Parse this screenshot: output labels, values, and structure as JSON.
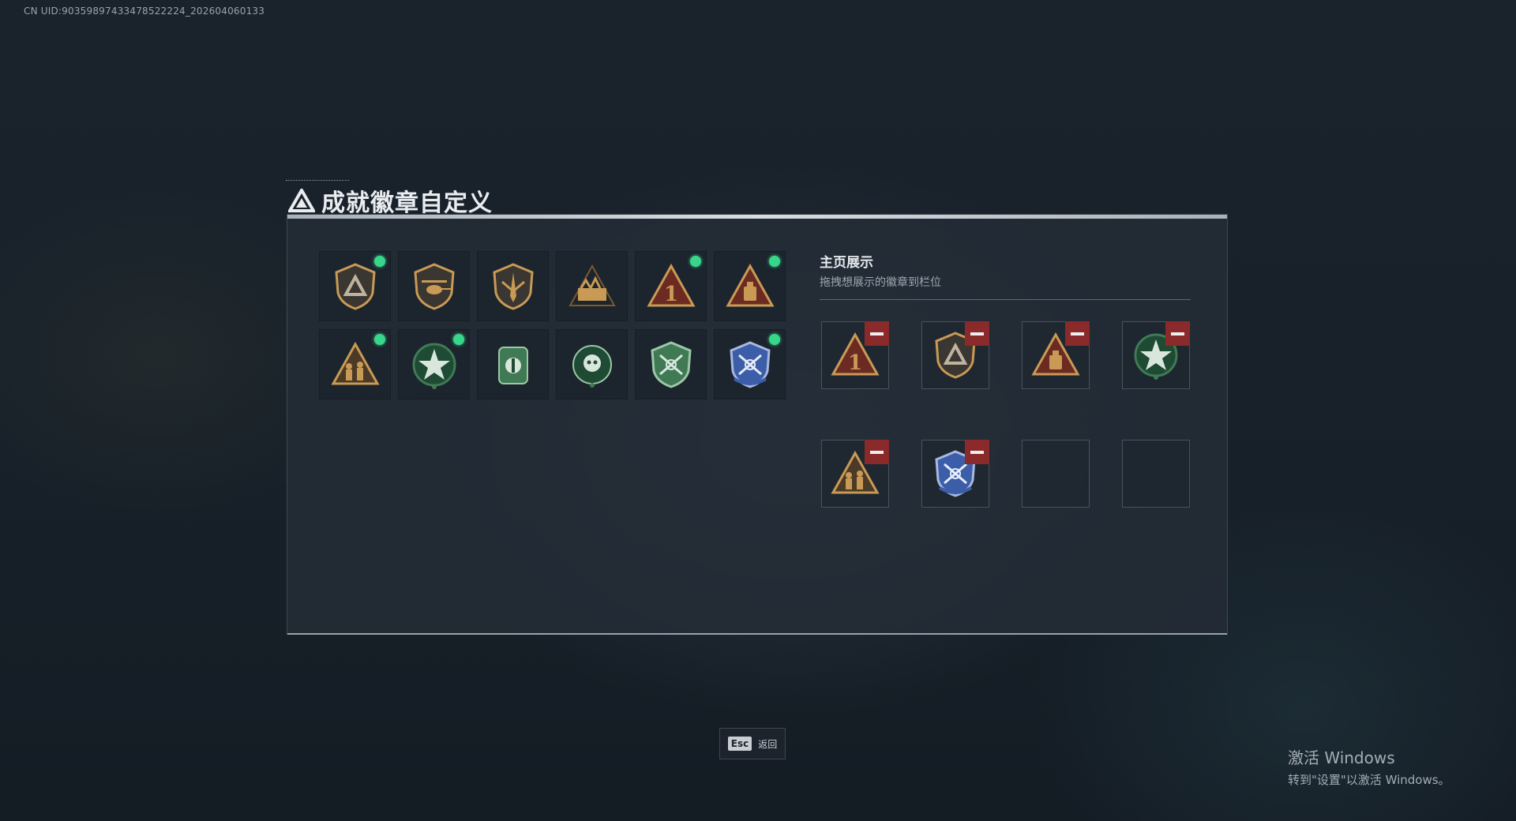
{
  "uid": "CN UID:90359897433478522224_202604060133",
  "title": "成就徽章自定义",
  "showcase": {
    "title": "主页展示",
    "subtitle": "拖拽想展示的徽章到栏位"
  },
  "badges": [
    {
      "icon": "shield-triangle-badge",
      "equipped": true
    },
    {
      "icon": "helicopter-shield-badge",
      "equipped": false
    },
    {
      "icon": "blade-shield-badge",
      "equipped": false
    },
    {
      "icon": "ammo-crate-badge",
      "equipped": false
    },
    {
      "icon": "number-one-triangle-badge",
      "equipped": true
    },
    {
      "icon": "backpack-triangle-badge",
      "equipped": true
    },
    {
      "icon": "soldiers-triangle-badge",
      "equipped": true
    },
    {
      "icon": "green-star-badge",
      "equipped": true
    },
    {
      "icon": "green-emblem-badge",
      "equipped": false
    },
    {
      "icon": "green-skull-badge",
      "equipped": false
    },
    {
      "icon": "green-shield-rifles-badge",
      "equipped": false
    },
    {
      "icon": "blue-shield-rifles-badge",
      "equipped": true
    }
  ],
  "slots": [
    {
      "icon": "number-one-triangle-badge"
    },
    {
      "icon": "shield-triangle-badge"
    },
    {
      "icon": "backpack-triangle-badge"
    },
    {
      "icon": "green-star-badge"
    },
    {
      "icon": "soldiers-triangle-badge"
    },
    {
      "icon": "blue-shield-rifles-badge"
    },
    {
      "icon": ""
    },
    {
      "icon": ""
    }
  ],
  "esc": {
    "key": "Esc",
    "label": "返回"
  },
  "windows": {
    "line1": "激活 Windows",
    "line2": "转到\"设置\"以激活 Windows。"
  }
}
